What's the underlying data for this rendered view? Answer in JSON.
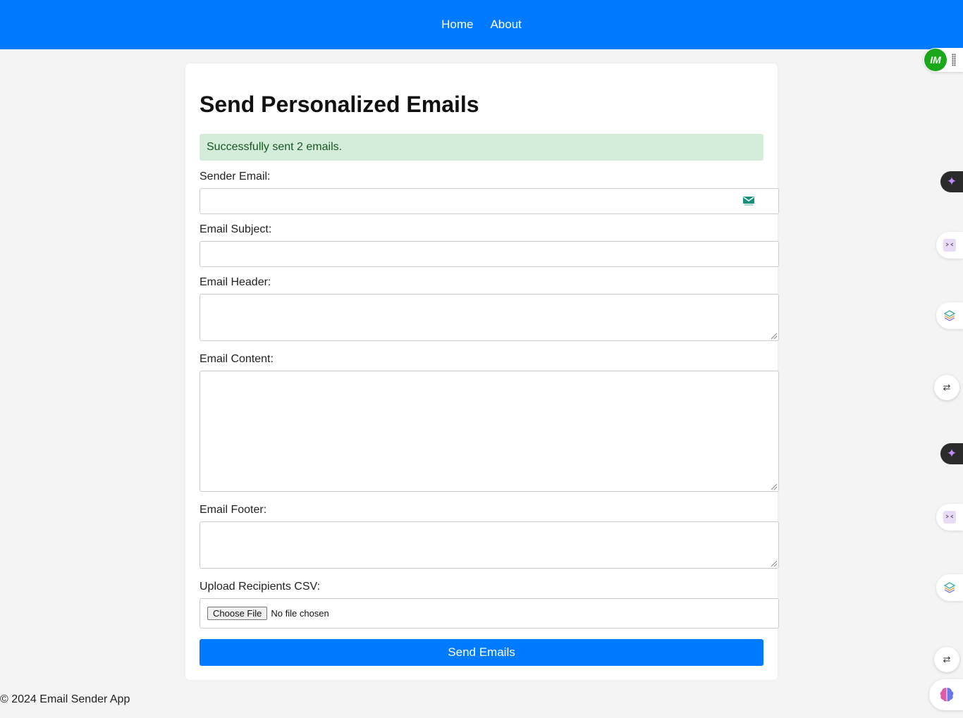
{
  "nav": {
    "home": "Home",
    "about": "About"
  },
  "page": {
    "title": "Send Personalized Emails"
  },
  "alert": {
    "message": "Successfully sent 2 emails."
  },
  "form": {
    "sender_label": "Sender Email:",
    "sender_value": "",
    "subject_label": "Email Subject:",
    "subject_value": "",
    "header_label": "Email Header:",
    "header_value": "",
    "content_label": "Email Content:",
    "content_value": "",
    "footer_label": "Email Footer:",
    "footer_value": "",
    "csv_label": "Upload Recipients CSV:",
    "choose_file": "Choose File",
    "no_file": "No file chosen",
    "submit": "Send Emails"
  },
  "footer": {
    "text": "© 2024 Email Sender App"
  },
  "extensions": {
    "im_badge": "IM",
    "sparkle_icon": "✦",
    "translate_icon": "⇄"
  },
  "colors": {
    "primary": "#007bff",
    "alert_bg": "#d4edda",
    "alert_text": "#155724",
    "im_green": "#1aa81a"
  }
}
